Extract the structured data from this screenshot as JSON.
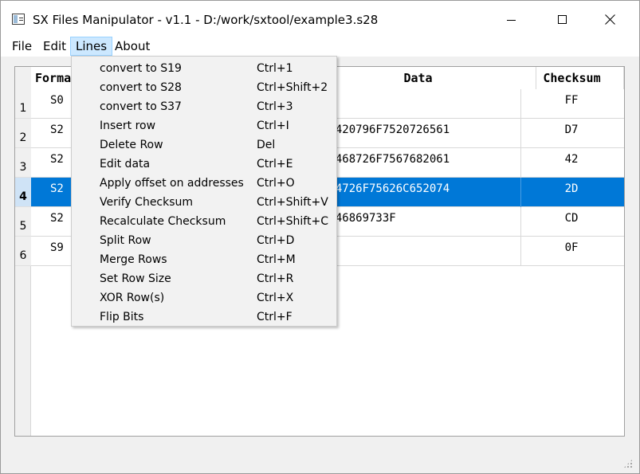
{
  "window": {
    "title": "SX Files Manipulator - v1.1 - D:/work/sxtool/example3.s28",
    "icon": "app-window-icon"
  },
  "menubar": {
    "file": "File",
    "edit": "Edit",
    "lines": "Lines",
    "about": "About"
  },
  "table": {
    "headers": {
      "format": "Format",
      "data": "Data",
      "checksum": "Checksum"
    },
    "rows": [
      {
        "num": "1",
        "format": "S0",
        "data": "",
        "checksum": "FF"
      },
      {
        "num": "2",
        "format": "S2",
        "data": "96420796F7520726561",
        "checksum": "D7"
      },
      {
        "num": "3",
        "format": "S2",
        "data": "07468726F7567682061",
        "checksum": "42"
      },
      {
        "num": "4",
        "format": "S2",
        "data": "074726F75626C652074",
        "checksum": "2D"
      },
      {
        "num": "5",
        "format": "S2",
        "data": "0746869733F",
        "checksum": "CD"
      },
      {
        "num": "6",
        "format": "S9",
        "data": "",
        "checksum": "0F"
      }
    ],
    "selected_row": "4",
    "selection_color": "#0078d7"
  },
  "lines_menu": {
    "items": [
      {
        "label": "convert to S19",
        "shortcut": "Ctrl+1"
      },
      {
        "label": "convert to S28",
        "shortcut": "Ctrl+Shift+2"
      },
      {
        "label": "convert to S37",
        "shortcut": "Ctrl+3"
      },
      {
        "label": "Insert row",
        "shortcut": "Ctrl+I"
      },
      {
        "label": "Delete Row",
        "shortcut": "Del"
      },
      {
        "label": "Edit data",
        "shortcut": "Ctrl+E"
      },
      {
        "label": "Apply offset on addresses",
        "shortcut": "Ctrl+O"
      },
      {
        "label": "Verify Checksum",
        "shortcut": "Ctrl+Shift+V"
      },
      {
        "label": "Recalculate Checksum",
        "shortcut": "Ctrl+Shift+C"
      },
      {
        "label": "Split Row",
        "shortcut": "Ctrl+D"
      },
      {
        "label": "Merge Rows",
        "shortcut": "Ctrl+M"
      },
      {
        "label": "Set Row Size",
        "shortcut": "Ctrl+R"
      },
      {
        "label": "XOR Row(s)",
        "shortcut": "Ctrl+X"
      },
      {
        "label": "Flip Bits",
        "shortcut": "Ctrl+F"
      }
    ]
  }
}
